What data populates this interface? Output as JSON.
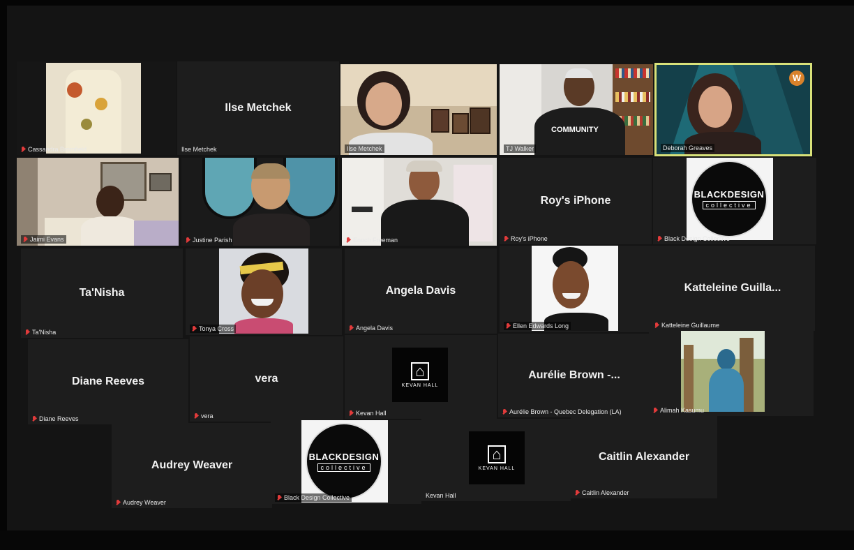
{
  "meeting": {
    "raised_hand_icon": "raised-hand-icon",
    "active_speaker_color": "#d9e27a",
    "muted_icon": "microphone-muted-icon"
  },
  "tiles": {
    "cassandra": {
      "label": "Cassandra Bromfield"
    },
    "ilse_name": {
      "name": "Ilse Metchek",
      "label": "Ilse Metchek"
    },
    "ilse_video": {
      "label": "Ilse Metchek"
    },
    "ti": {
      "label": "TJ Walker",
      "shirt_text": "COMMUNITY"
    },
    "deborah": {
      "label": "Deborah Greaves",
      "badge": "W"
    },
    "jaimi": {
      "label": "Jaimi Evans"
    },
    "justine": {
      "label": "Justine Parish"
    },
    "enoch": {
      "label": "Enoch Freeman"
    },
    "roy": {
      "name": "Roy's iPhone",
      "label": "Roy's iPhone"
    },
    "bdc1": {
      "label": "Black Design Collective",
      "logo_line1": "BLACKDESIGN",
      "logo_line2": "collective"
    },
    "tanisha": {
      "name": "Ta'Nisha",
      "label": "Ta'Nisha"
    },
    "tonya": {
      "label": "Tonya Cross"
    },
    "angela": {
      "name": "Angela Davis",
      "label": "Angela Davis"
    },
    "ellen": {
      "label": "Ellen Edwards Long"
    },
    "katteleine": {
      "name": "Katteleine  Guilla...",
      "label": "Katteleine Guillaume"
    },
    "diane": {
      "name": "Diane Reeves",
      "label": "Diane Reeves"
    },
    "vera": {
      "name": "vera",
      "label": "vera"
    },
    "kevan1": {
      "label": "Kevan Hall",
      "logo_text": "KEVAN HALL"
    },
    "aurelie": {
      "name": "Aurélie  Brown  -...",
      "label": "Aurélie Brown - Quebec Delegation (LA)"
    },
    "alimah": {
      "label": "Alimah Kasumu"
    },
    "audrey": {
      "name": "Audrey Weaver",
      "label": "Audrey Weaver"
    },
    "bdc2": {
      "label": "Black Design Collective",
      "logo_line1": "BLACKDESIGN",
      "logo_line2": "collective"
    },
    "kevan2": {
      "label": "Kevan Hall",
      "logo_text": "KEVAN HALL"
    },
    "caitlin": {
      "name": "Caitlin Alexander",
      "label": "Caitlin Alexander"
    }
  }
}
